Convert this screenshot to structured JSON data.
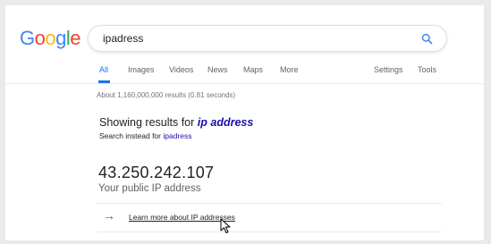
{
  "logo": {
    "letters": [
      "G",
      "o",
      "o",
      "g",
      "l",
      "e"
    ],
    "colors": [
      "#4285f4",
      "#ea4335",
      "#fbbc05",
      "#4285f4",
      "#34a853",
      "#ea4335"
    ]
  },
  "search": {
    "query": "ipadress",
    "icon": "search-icon",
    "accent": "#4285f4"
  },
  "tabs": {
    "all": "All",
    "images": "Images",
    "videos": "Videos",
    "news": "News",
    "maps": "Maps",
    "more": "More",
    "settings": "Settings",
    "tools": "Tools"
  },
  "results": {
    "stats": "About 1,160,000,000 results (0.81 seconds)",
    "showing_prefix": "Showing results for ",
    "corrected_query": "ip address",
    "instead_prefix": "Search instead for ",
    "original_query": "ipadress"
  },
  "ip_card": {
    "ip": "43.250.242.107",
    "caption": "Your public IP address",
    "arrow_icon": "arrow-right-icon",
    "learn_more": "Learn more about IP addresses"
  },
  "colors": {
    "link": "#1a0dab",
    "active_tab": "#1a73e8"
  }
}
